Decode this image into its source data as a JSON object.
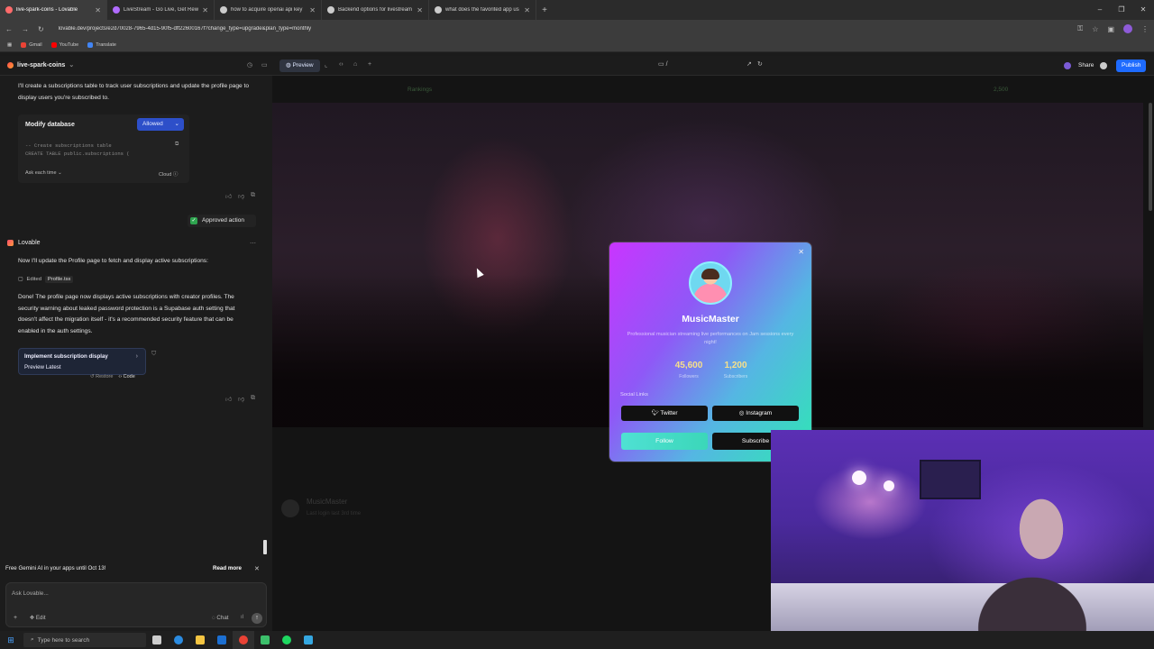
{
  "browser": {
    "tabs": [
      {
        "title": "live-spark-coins - Lovable",
        "active": true,
        "color": "#ff6b6b"
      },
      {
        "title": "LiveStream - Go Live, Get Rewa",
        "active": false,
        "color": "#b06bff"
      },
      {
        "title": "how to acquire openai api key",
        "active": false,
        "color": "#cccccc"
      },
      {
        "title": "Backend options for livestream",
        "active": false,
        "color": "#cccccc"
      },
      {
        "title": "what does the favorited app us",
        "active": false,
        "color": "#cccccc"
      }
    ],
    "url": "lovable.dev/projects/e2d70028-7965-4d15-90f5-dff22600167f?change_type=upgrade&plan_type=monthly",
    "bookmarks": [
      {
        "label": "Gmail",
        "color": "#ea4335"
      },
      {
        "label": "YouTube",
        "color": "#ff0000"
      },
      {
        "label": "Translate",
        "color": "#4285f4"
      }
    ],
    "window_controls": [
      "–",
      "❐",
      "✕"
    ]
  },
  "app": {
    "project_name": "live-spark-coins",
    "preview_label": "Preview",
    "path": "/",
    "share_label": "Share",
    "publish_label": "Publish"
  },
  "chat": {
    "intro": "I'll create a subscriptions table to track user subscriptions and update the profile page to display users you're subscribed to.",
    "db_card": {
      "title": "Modify database",
      "allowed_label": "Allowed",
      "sql": "-- Create subscriptions table\nCREATE TABLE public.subscriptions (",
      "ask_label": "Ask each time",
      "cloud_label": "Cloud"
    },
    "approved_label": "Approved action",
    "author": "Lovable",
    "update_msg": "Now I'll update the Profile page to fetch and display active subscriptions:",
    "edited_label": "Edited",
    "edited_file": "Profile.tsx",
    "done_msg": "Done! The profile page now displays active subscriptions with creator profiles. The security warning about leaked password protection is a Supabase auth setting that doesn't affect the migration itself - it's a recommended security feature that can be enabled in the auth settings.",
    "impl_card": {
      "title": "Implement subscription display",
      "subtitle": "Preview Latest"
    },
    "restore_label": "Restore",
    "code_label": "Code",
    "banner_text": "Free Gemini AI in your apps until Oct 13!",
    "read_more": "Read more",
    "input_placeholder": "Ask Lovable...",
    "edit_label": "Edit",
    "chat_label": "Chat"
  },
  "preview": {
    "top_nav": "Rankings",
    "top_coins": "2,500",
    "lower_name": "MusicMaster",
    "lower_sub": "Last login last 3rd time"
  },
  "modal": {
    "username": "MusicMaster",
    "bio": "Professional musician streaming live performances on Jam sessions every night!",
    "followers": "45,600",
    "followers_label": "Followers",
    "subscribers": "1,200",
    "subscribers_label": "Subscribers",
    "social_label": "Social Links",
    "twitter": "Twitter",
    "instagram": "Instagram",
    "follow": "Follow",
    "subscribe": "Subscribe"
  },
  "taskbar": {
    "search_placeholder": "Type here to search",
    "icons": [
      {
        "name": "task-view-icon",
        "color": "#cccccc"
      },
      {
        "name": "edge-icon",
        "color": "#2b8be0"
      },
      {
        "name": "explorer-icon",
        "color": "#f4c542"
      },
      {
        "name": "outlook-icon",
        "color": "#1c6fd1"
      },
      {
        "name": "chrome-icon",
        "color": "#e94235"
      },
      {
        "name": "terminal-icon",
        "color": "#3cbf6b"
      },
      {
        "name": "spotify-icon",
        "color": "#1ed760"
      },
      {
        "name": "telegram-icon",
        "color": "#35a7e0"
      }
    ]
  }
}
